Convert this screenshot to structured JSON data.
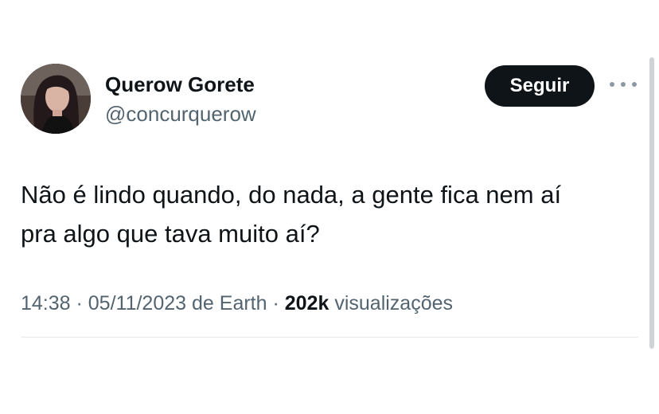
{
  "author": {
    "display_name": "Querow Gorete",
    "handle": "@concurquerow",
    "avatar_icon": "profile-photo"
  },
  "follow_label": "Seguir",
  "more_icon": "more-horizontal-icon",
  "tweet": {
    "line1": "Não é lindo quando, do nada, a gente fica nem aí",
    "line2": "pra algo que tava muito aí?"
  },
  "meta": {
    "time": "14:38",
    "separator": " · ",
    "date": "05/11/2023",
    "source": "de Earth",
    "views_count": "202k",
    "views_label": "visualizações"
  },
  "colors": {
    "text_primary": "#0f1419",
    "text_secondary": "#536471",
    "button_bg": "#0f1419",
    "button_text": "#ffffff"
  }
}
